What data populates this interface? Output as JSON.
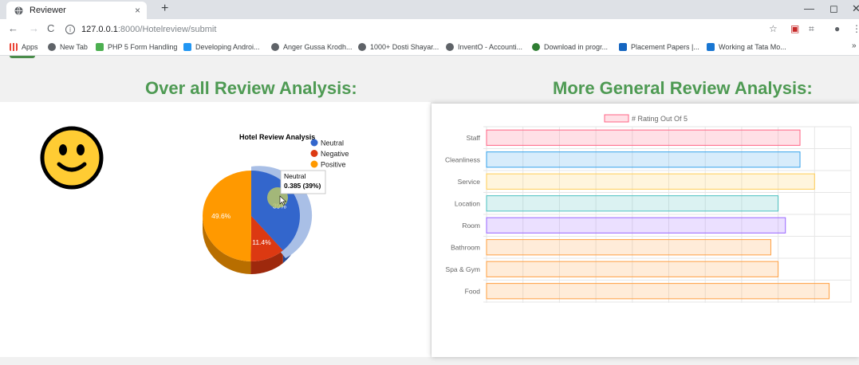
{
  "browser": {
    "tab_title": "Reviewer",
    "tab_close": "×",
    "new_tab": "+",
    "url_host": "127.0.0.1",
    "url_path": ":8000/Hotelreview/submit",
    "bookmarks": [
      {
        "label": "Apps",
        "icon_color": "#ea4335"
      },
      {
        "label": "New Tab",
        "icon_color": "globe"
      },
      {
        "label": "PHP 5 Form Handling",
        "icon_color": "#4caf50"
      },
      {
        "label": "Developing Androi...",
        "icon_color": "#2196f3"
      },
      {
        "label": "Anger Gussa Krodh...",
        "icon_color": "globe"
      },
      {
        "label": "1000+ Dosti Shayar...",
        "icon_color": "globe"
      },
      {
        "label": "InventO - Accounti...",
        "icon_color": "globe"
      },
      {
        "label": "Download in progr...",
        "icon_color": "#2e7d32"
      },
      {
        "label": "Placement Papers |...",
        "icon_color": "#1565c0"
      },
      {
        "label": "Working at Tata Mo...",
        "icon_color": "#1976d2"
      }
    ]
  },
  "page": {
    "left_heading": "Over all Review Analysis:",
    "right_heading": "More General Review Analysis:"
  },
  "chart_data": [
    {
      "type": "pie",
      "title": "Hotel Review Analysis",
      "legend_position": "top-right",
      "categories": [
        "Neutral",
        "Negative",
        "Positive"
      ],
      "values": [
        0.385,
        0.114,
        0.496
      ],
      "colors": [
        "#3366cc",
        "#dc3912",
        "#ff9900"
      ],
      "data_labels": [
        "39%",
        "11.4%",
        "49.6%"
      ],
      "tooltip": {
        "label": "Neutral",
        "value": "0.385 (39%)"
      }
    },
    {
      "type": "bar",
      "orientation": "horizontal",
      "legend": "# Rating Out Of 5",
      "categories": [
        "Staff",
        "Cleanliness",
        "Service",
        "Location",
        "Room",
        "Bathroom",
        "Spa & Gym",
        "Food"
      ],
      "values": [
        4.3,
        4.3,
        4.5,
        4.0,
        4.1,
        3.9,
        4.0,
        4.7
      ],
      "fill_colors": [
        "rgba(255,99,132,0.2)",
        "rgba(54,162,235,0.2)",
        "rgba(255,206,86,0.2)",
        "rgba(75,192,192,0.2)",
        "rgba(153,102,255,0.2)",
        "rgba(255,159,64,0.2)",
        "rgba(255,159,64,0.2)",
        "rgba(255,159,64,0.2)"
      ],
      "border_colors": [
        "rgba(255,99,132,1)",
        "rgba(54,162,235,1)",
        "rgba(255,206,86,1)",
        "rgba(75,192,192,1)",
        "rgba(153,102,255,1)",
        "rgba(255,159,64,1)",
        "rgba(255,159,64,1)",
        "rgba(255,159,64,1)"
      ],
      "xlim": [
        0,
        5
      ],
      "xticks": [
        "0",
        "0.5",
        "1.0",
        "1.5",
        "2.0",
        "2.5",
        "3.0",
        "3.5",
        "4.0",
        "4.5",
        "5.0"
      ],
      "grid": true
    }
  ]
}
